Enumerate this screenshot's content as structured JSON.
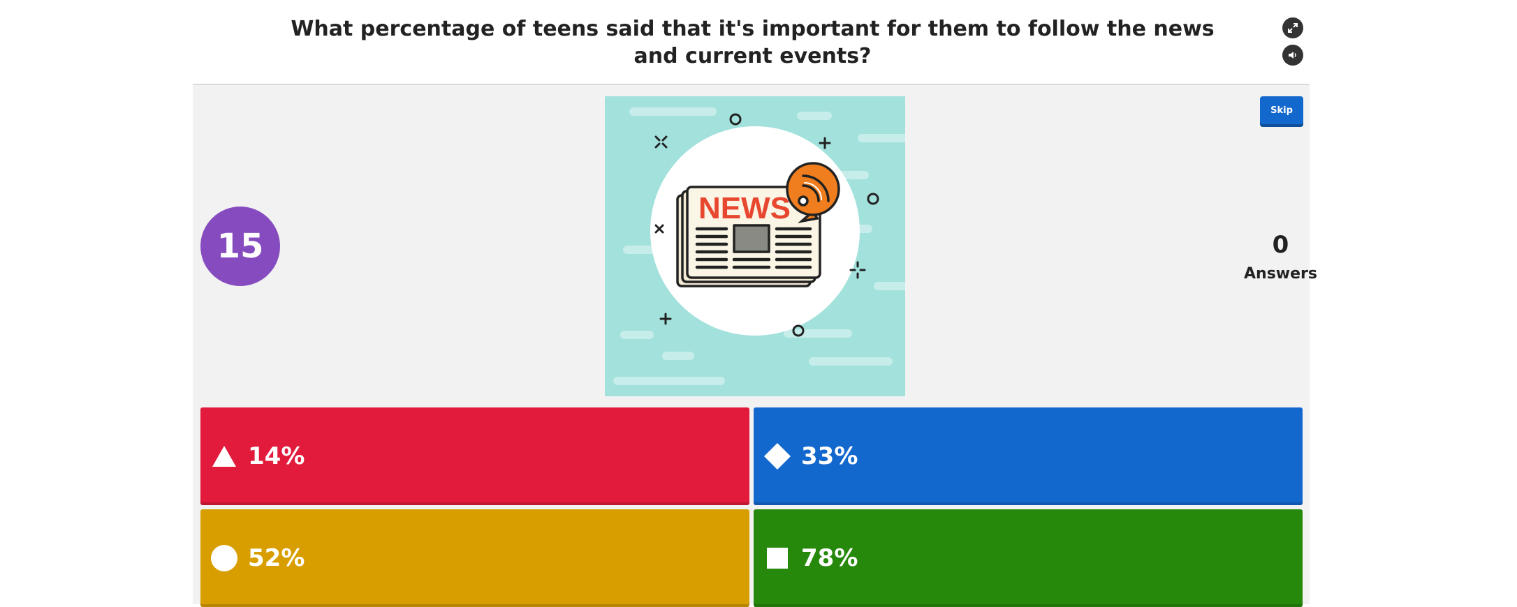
{
  "question": "What percentage of teens said that it's important for them to follow the news and current events?",
  "controls": {
    "fullscreen_icon": "fullscreen-icon",
    "sound_icon": "volume-icon"
  },
  "timer": "15",
  "skip_label": "Skip",
  "answers_count": "0",
  "answers_label": "Answers",
  "image": {
    "newspaper_headline": "NEWS",
    "icon": "newspaper-rss-illustration"
  },
  "options": [
    {
      "label": "14%",
      "shape": "triangle",
      "color": "#e21b3c"
    },
    {
      "label": "33%",
      "shape": "diamond",
      "color": "#1368ce"
    },
    {
      "label": "52%",
      "shape": "circle",
      "color": "#d89e00"
    },
    {
      "label": "78%",
      "shape": "square",
      "color": "#26890c"
    }
  ],
  "colors": {
    "timer": "#864cbf",
    "skip": "#1368ce",
    "background": "#f2f2f2"
  }
}
